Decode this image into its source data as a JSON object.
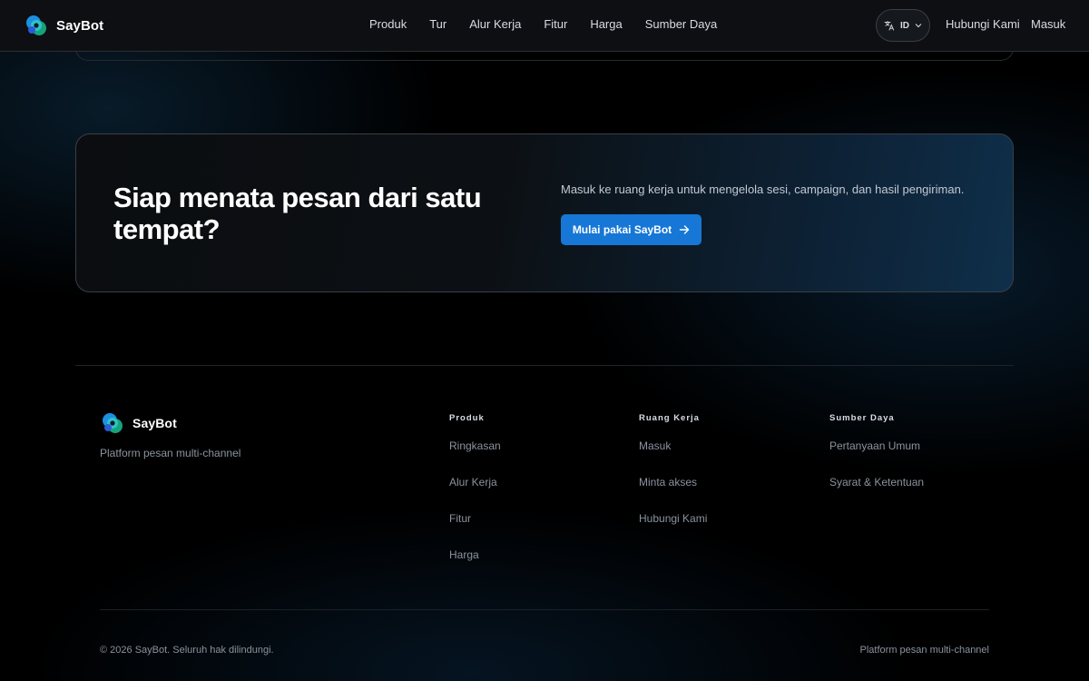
{
  "colors": {
    "accent": "#1677d6",
    "background": "#000000",
    "header_bg": "#0e1013"
  },
  "header": {
    "brand": "SayBot",
    "nav": [
      "Produk",
      "Tur",
      "Alur Kerja",
      "Fitur",
      "Harga",
      "Sumber Daya"
    ],
    "language": {
      "code": "ID",
      "icon": "translate-icon"
    },
    "contact_label": "Hubungi Kami",
    "login_label": "Masuk"
  },
  "cta": {
    "title": "Siap menata pesan dari satu tempat?",
    "subtitle": "Masuk ke ruang kerja untuk mengelola sesi, campaign, dan hasil pengiriman.",
    "button_label": "Mulai pakai SayBot",
    "button_icon": "arrow-right-icon"
  },
  "footer": {
    "brand": "SayBot",
    "tagline": "Platform pesan multi-channel",
    "columns": [
      {
        "heading": "Produk",
        "links": [
          "Ringkasan",
          "Alur Kerja",
          "Fitur",
          "Harga"
        ]
      },
      {
        "heading": "Ruang Kerja",
        "links": [
          "Masuk",
          "Minta akses",
          "Hubungi Kami"
        ]
      },
      {
        "heading": "Sumber Daya",
        "links": [
          "Pertanyaan Umum",
          "Syarat & Ketentuan"
        ]
      }
    ],
    "copyright": "© 2026 SayBot. Seluruh hak dilindungi.",
    "bottom_right": "Platform pesan multi-channel"
  }
}
